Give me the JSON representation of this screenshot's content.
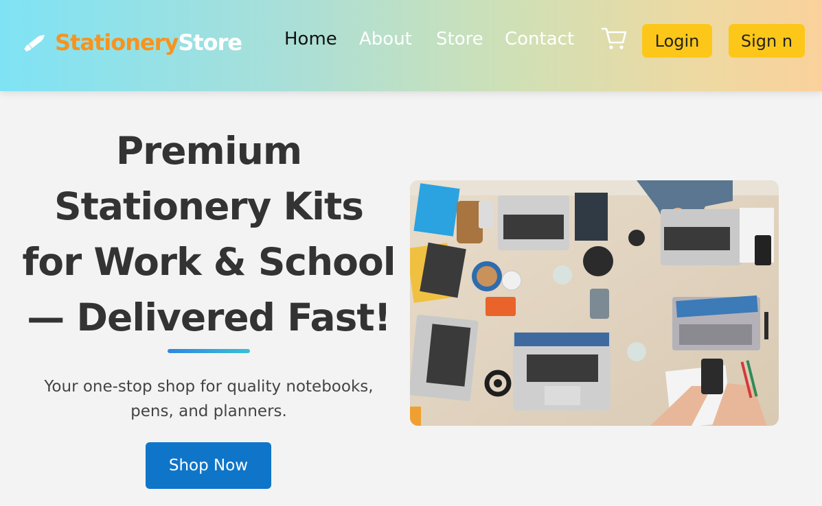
{
  "brand": {
    "part1": "Stationery",
    "part2": "Store",
    "icon": "pen-icon"
  },
  "nav": {
    "home": "Home",
    "about": "About",
    "store": "Store",
    "contact": "Contact"
  },
  "cart": {
    "icon": "cart-icon"
  },
  "auth": {
    "login": "Login",
    "signup": "Sign n"
  },
  "hero": {
    "title": "Premium Stationery Kits for Work & School — Delivered Fast!",
    "subtitle": "Your one-stop shop for quality notebooks, pens, and planners.",
    "cta": "Shop Now"
  },
  "colors": {
    "accent": "#f7931e",
    "button_yellow": "#fcc719",
    "cta_blue": "#0f75c9"
  }
}
